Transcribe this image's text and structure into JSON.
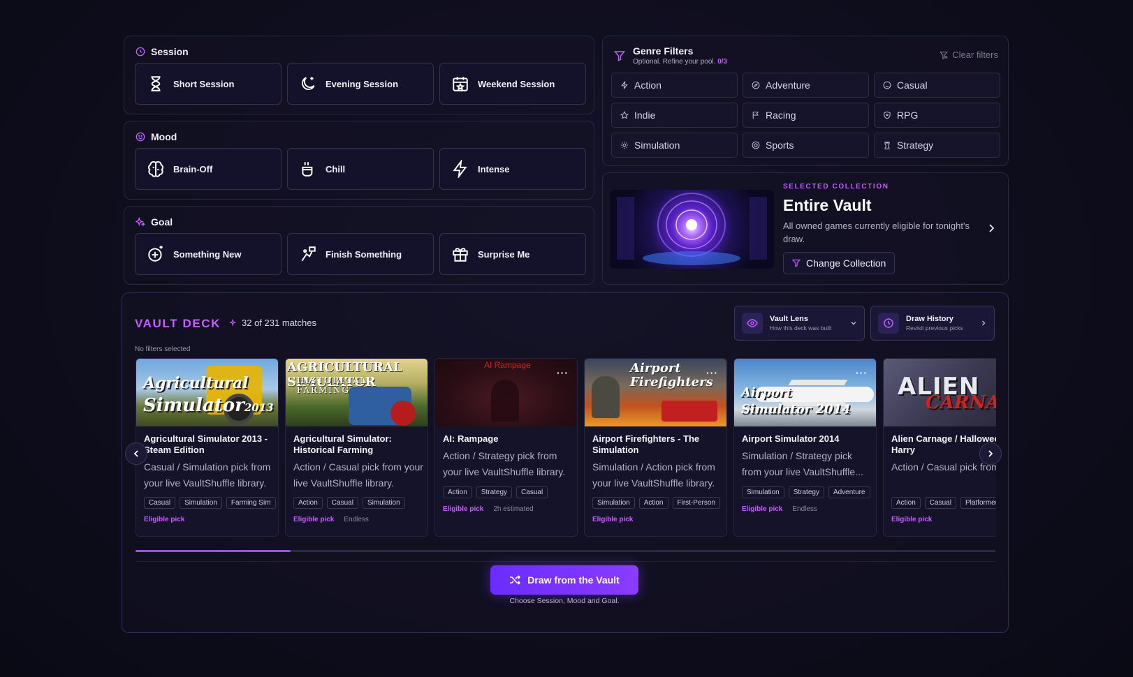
{
  "session": {
    "title": "Session",
    "options": [
      "Short Session",
      "Evening Session",
      "Weekend Session"
    ]
  },
  "mood": {
    "title": "Mood",
    "options": [
      "Brain-Off",
      "Chill",
      "Intense"
    ]
  },
  "goal": {
    "title": "Goal",
    "options": [
      "Something New",
      "Finish Something",
      "Surprise Me"
    ]
  },
  "genre_filters": {
    "title": "Genre Filters",
    "subtitle": "Optional. Refine your pool.",
    "count": "0/3",
    "clear_label": "Clear filters",
    "genres": [
      "Action",
      "Adventure",
      "Casual",
      "Indie",
      "Racing",
      "RPG",
      "Simulation",
      "Sports",
      "Strategy"
    ]
  },
  "collection": {
    "eyebrow": "SELECTED COLLECTION",
    "title": "Entire Vault",
    "description": "All owned games currently eligible for tonight's draw.",
    "change_label": "Change Collection"
  },
  "deck": {
    "title": "VAULT DECK",
    "matches": "32 of 231 matches",
    "filters_status": "No filters selected",
    "vault_lens": {
      "title": "Vault Lens",
      "subtitle": "How this deck was built"
    },
    "draw_history": {
      "title": "Draw History",
      "subtitle": "Revisit previous picks"
    },
    "scroll_progress": 0.18,
    "cards": [
      {
        "img_text": "Agricultural Simulator 2013",
        "title": "Agricultural Simulator 2013 - Steam Edition",
        "desc": "Casual / Simulation pick from your live VaultShuffle library.",
        "tags": [
          "Casual",
          "Simulation",
          "Farming Sim"
        ],
        "eligible": "Eligible pick",
        "extra": ""
      },
      {
        "img_text": "AGRICULTURAL SIMULATOR HISTORICAL FARMING",
        "title": "Agricultural Simulator: Historical Farming",
        "desc": "Action / Casual pick from your live VaultShuffle library.",
        "tags": [
          "Action",
          "Casual",
          "Simulation"
        ],
        "eligible": "Eligible pick",
        "extra": "Endless"
      },
      {
        "img_text": "AI Rampage",
        "title": "AI: Rampage",
        "desc": "Action / Strategy pick from your live VaultShuffle library.",
        "tags": [
          "Action",
          "Strategy",
          "Casual"
        ],
        "eligible": "Eligible pick",
        "extra": "2h estimated"
      },
      {
        "img_text": "Airport Firefighters",
        "title": "Airport Firefighters - The Simulation",
        "desc": "Simulation / Action pick from your live VaultShuffle library.",
        "tags": [
          "Simulation",
          "Action",
          "First-Person"
        ],
        "eligible": "Eligible pick",
        "extra": ""
      },
      {
        "img_text": "Airport Simulator 2014",
        "title": "Airport Simulator 2014",
        "desc": "Simulation / Strategy pick from your live VaultShuffle...",
        "tags": [
          "Simulation",
          "Strategy",
          "Adventure"
        ],
        "eligible": "Eligible pick",
        "extra": "Endless"
      },
      {
        "img_text": "ALIEN CARNAGE",
        "title": "Alien Carnage / Halloween Harry",
        "desc": "Action / Casual pick from your live VaultShuffle library.",
        "tags": [
          "Action",
          "Casual",
          "Platformer"
        ],
        "eligible": "Eligible pick",
        "extra": ""
      }
    ],
    "draw_button": "Draw from the Vault",
    "draw_hint": "Choose Session, Mood and Goal."
  },
  "colors": {
    "accent": "#c85cff",
    "primary": "#7a34ff",
    "background": "#0e0d1c"
  }
}
